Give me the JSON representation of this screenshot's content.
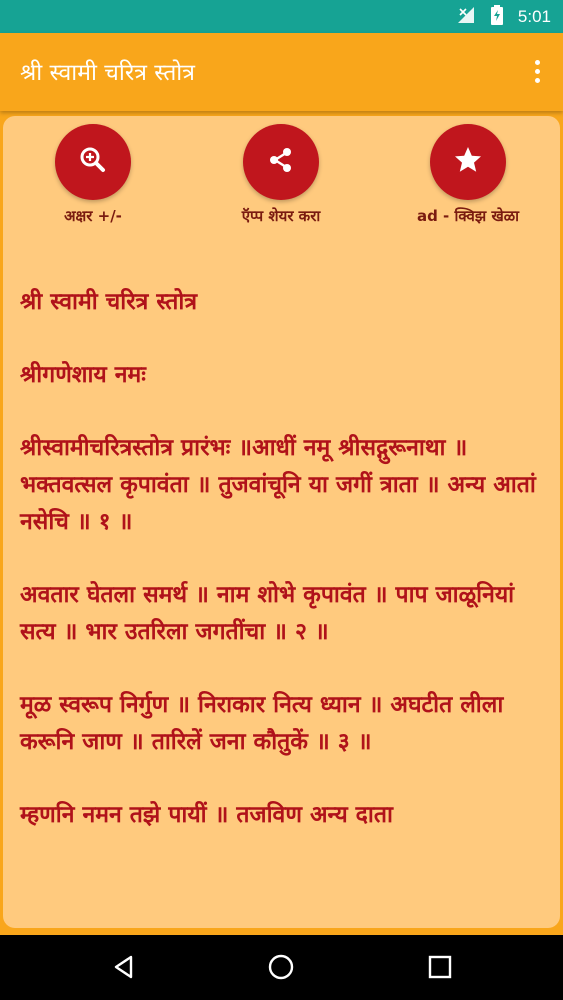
{
  "status": {
    "time": "5:01"
  },
  "app": {
    "title": "श्री स्वामी चरित्र स्तोत्र"
  },
  "actions": [
    {
      "label": "अक्षर +/-",
      "icon": "zoom-icon"
    },
    {
      "label": "ऍप्प शेयर करा",
      "icon": "share-icon"
    },
    {
      "label": "ad - क्विझ खेळा",
      "icon": "star-icon"
    }
  ],
  "content": {
    "title": "श्री स्वामी चरित्र स्तोत्र",
    "invocation": "श्रीगणेशाय नमः",
    "verses": [
      "श्रीस्वामीचरित्रस्तोत्र प्रारंभः ॥आधीं नमू श्रीसद्गुरूनाथा ॥ भक्तवत्सल कृपावंता ॥ तुजवांचूनि या जगीं त्राता ॥ अन्य आतां नसेचि ॥ १ ॥",
      "अवतार घेतला समर्थ ॥ नाम शोभे कृपावंत ॥ पाप जाळूनियां सत्य ॥ भार उतरिला जगतींचा ॥ २ ॥",
      "मूळ स्वरूप निर्गुण ॥ निराकार नित्य ध्यान ॥ अघटीत लीला करूनि जाण ॥ तारिलें जना कौतुकें ॥ ३ ॥",
      "म्हणनि नमन तझे पायीं ॥ तजविण अन्य दाता"
    ]
  },
  "colors": {
    "status_bar": "#16A394",
    "app_bar": "#F9A61B",
    "card": "#FFCA7E",
    "accent": "#C0161D",
    "text": "#B0121A"
  }
}
